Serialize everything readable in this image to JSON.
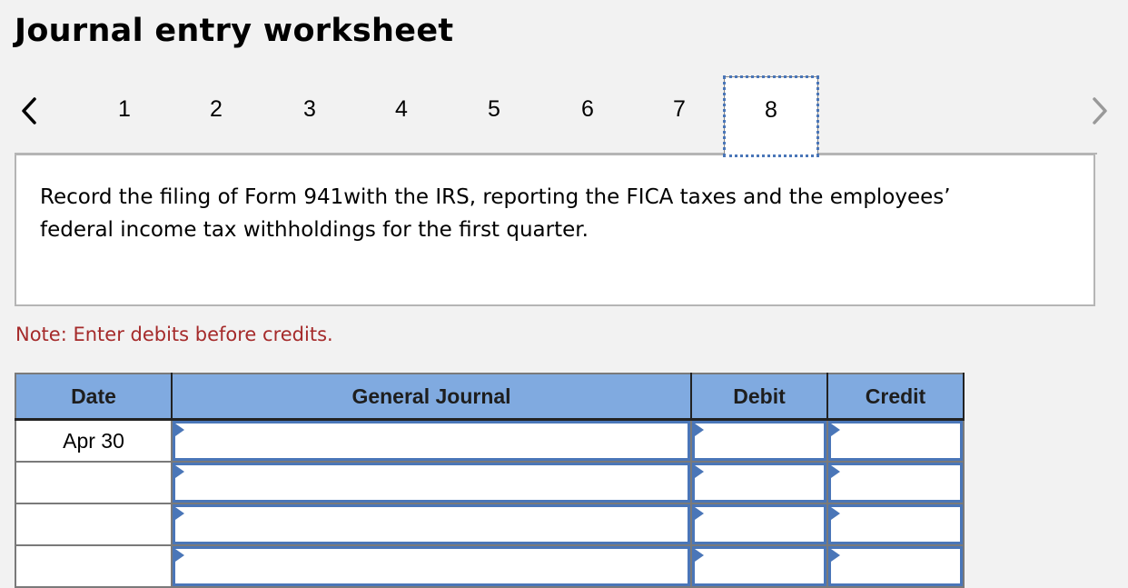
{
  "header": {
    "title": "Journal entry worksheet"
  },
  "navigation": {
    "prev_icon": "chevron-left-icon",
    "next_icon": "chevron-right-icon",
    "steps": [
      "1",
      "2",
      "3",
      "4",
      "5",
      "6",
      "7",
      "8"
    ],
    "active_step": "8"
  },
  "question": {
    "text": "Record the filing of Form 941with the IRS, reporting the FICA taxes and the employees’ federal income tax withholdings for the first quarter."
  },
  "note": "Note: Enter debits before credits.",
  "journal": {
    "columns": [
      "Date",
      "General Journal",
      "Debit",
      "Credit"
    ],
    "rows": [
      {
        "date": "Apr 30",
        "account": "",
        "debit": "",
        "credit": ""
      },
      {
        "date": "",
        "account": "",
        "debit": "",
        "credit": ""
      },
      {
        "date": "",
        "account": "",
        "debit": "",
        "credit": ""
      },
      {
        "date": "",
        "account": "",
        "debit": "",
        "credit": ""
      }
    ]
  },
  "colors": {
    "accent": "#4a76b8",
    "header_bg": "#80aae0",
    "note": "#a52a2a"
  }
}
